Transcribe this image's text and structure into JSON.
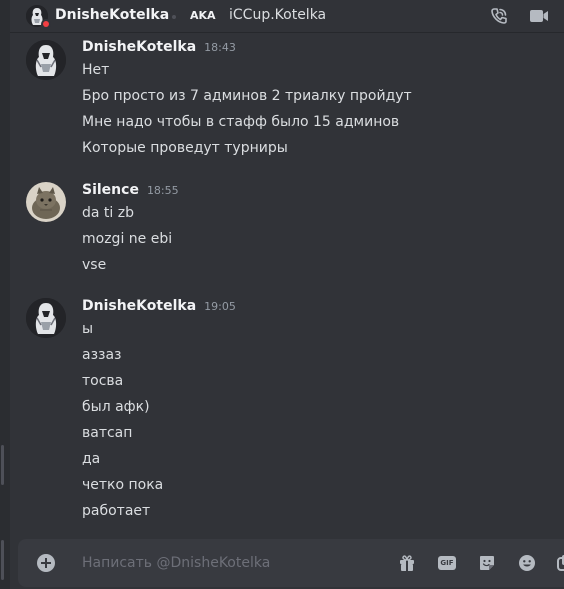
{
  "header": {
    "username": "DnisheKotelka",
    "aka_label": "AKA",
    "aka_name": "iCCup.Kotelka",
    "icons": [
      "phone-call-icon",
      "video-camera-icon"
    ]
  },
  "messages": [
    {
      "author": "DnisheKotelka",
      "time": "18:43",
      "lines": [
        "Нет",
        "Бро просто из 7 админов 2 триалку пройдут",
        "Мне надо чтобы в стафф было 15 админов",
        "Которые проведут турниры"
      ]
    },
    {
      "author": "Silence",
      "time": "18:55",
      "lines": [
        "da ti zb",
        "mozgi ne ebi",
        "vse"
      ]
    },
    {
      "author": "DnisheKotelka",
      "time": "19:05",
      "lines": [
        "ы",
        "аззаз",
        "тосва",
        "был афк)",
        "ватсап",
        "да",
        "четко пока",
        "работает"
      ]
    }
  ],
  "composer": {
    "placeholder": "Написать @DnisheKotelka",
    "value": "",
    "gif_label": "GIF",
    "icons": [
      "add-attachment-icon",
      "gift-icon",
      "gif-icon",
      "sticker-icon",
      "emoji-icon",
      "apps-icon"
    ]
  },
  "colors": {
    "background": "#313338",
    "composer": "#383a40",
    "text": "#dbdee1",
    "username": "#f2f3f5",
    "timestamp": "#949ba4",
    "status_dnd": "#f23f43"
  }
}
